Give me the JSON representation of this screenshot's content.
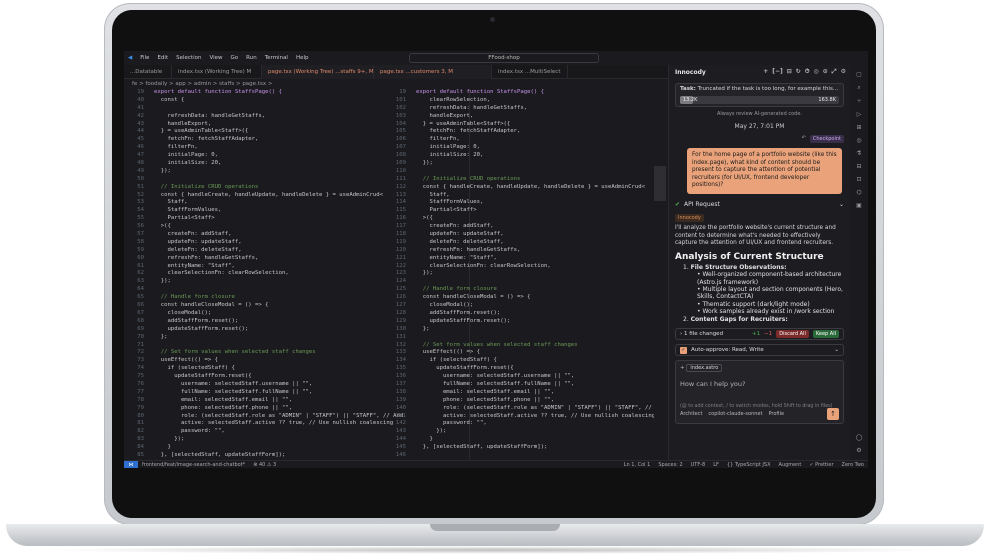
{
  "menu": {
    "logo": "◀",
    "items": [
      "File",
      "Edit",
      "Selection",
      "View",
      "Go",
      "Run",
      "Terminal",
      "Help"
    ]
  },
  "command_center": "FFood-shop",
  "tabs_left": [
    {
      "label": "...Datatable",
      "active": false
    },
    {
      "label": "index.tsx (Working Tree)  M",
      "active": false
    },
    {
      "label": "page.tsx (Working Tree) ...staffs 9+, M",
      "active": true
    }
  ],
  "tabs_right": [
    {
      "label": "page.tsx ...customers  3, M",
      "active": true
    },
    {
      "label": "index.tsx ...MultiSelect",
      "active": false
    }
  ],
  "breadcrumb": "fe > foodaily > app > admin > staffs > page.tsx >",
  "left_code": [
    {
      "n": "19",
      "t": "export default function StaffsPage() {",
      "k": "kw"
    },
    {
      "n": "40",
      "t": "  const {",
      "k": ""
    },
    {
      "n": "41",
      "t": "",
      "k": ""
    },
    {
      "n": "42",
      "t": "    refreshData: handleGetStaffs,",
      "k": ""
    },
    {
      "n": "43",
      "t": "    handleExport,",
      "k": ""
    },
    {
      "n": "44",
      "t": "  } = useAdminTable<Staff>({",
      "k": ""
    },
    {
      "n": "45",
      "t": "    fetchFn: fetchStaffAdapter,",
      "k": ""
    },
    {
      "n": "46",
      "t": "    filterFn,",
      "k": ""
    },
    {
      "n": "47",
      "t": "    initialPage: 0,",
      "k": ""
    },
    {
      "n": "48",
      "t": "    initialSize: 20,",
      "k": ""
    },
    {
      "n": "49",
      "t": "  });",
      "k": ""
    },
    {
      "n": "50",
      "t": "",
      "k": ""
    },
    {
      "n": "51",
      "t": "  // Initialize CRUD operations",
      "k": "cm"
    },
    {
      "n": "52",
      "t": "  const { handleCreate, handleUpdate, handleDelete } = useAdminCrud<",
      "k": ""
    },
    {
      "n": "53",
      "t": "    Staff,",
      "k": ""
    },
    {
      "n": "54",
      "t": "    StaffFormValues,",
      "k": ""
    },
    {
      "n": "55",
      "t": "    Partial<Staff>",
      "k": ""
    },
    {
      "n": "56",
      "t": "  >({",
      "k": ""
    },
    {
      "n": "57",
      "t": "    createFn: addStaff,",
      "k": ""
    },
    {
      "n": "58",
      "t": "    updateFn: updateStaff,",
      "k": ""
    },
    {
      "n": "59",
      "t": "    deleteFn: deleteStaff,",
      "k": ""
    },
    {
      "n": "60",
      "t": "    refreshFn: handleGetStaffs,",
      "k": ""
    },
    {
      "n": "61",
      "t": "    entityName: \"Staff\",",
      "k": ""
    },
    {
      "n": "62",
      "t": "    clearSelectionFn: clearRowSelection,",
      "k": ""
    },
    {
      "n": "63",
      "t": "  });",
      "k": ""
    },
    {
      "n": "64",
      "t": "",
      "k": ""
    },
    {
      "n": "65",
      "t": "  // Handle form closure",
      "k": "cm"
    },
    {
      "n": "66",
      "t": "  const handleCloseModal = () => {",
      "k": ""
    },
    {
      "n": "67",
      "t": "    closeModal();",
      "k": ""
    },
    {
      "n": "68",
      "t": "    addStaffForm.reset();",
      "k": ""
    },
    {
      "n": "69",
      "t": "    updateStaffForm.reset();",
      "k": ""
    },
    {
      "n": "70",
      "t": "  };",
      "k": ""
    },
    {
      "n": "71",
      "t": "",
      "k": ""
    },
    {
      "n": "72",
      "t": "  // Set form values when selected staff changes",
      "k": "cm"
    },
    {
      "n": "73",
      "t": "  useEffect(() => {",
      "k": ""
    },
    {
      "n": "74",
      "t": "    if (selectedStaff) {",
      "k": ""
    },
    {
      "n": "75",
      "t": "      updateStaffForm.reset({",
      "k": ""
    },
    {
      "n": "76",
      "t": "        username: selectedStaff.username || \"\",",
      "k": ""
    },
    {
      "n": "77",
      "t": "        fullName: selectedStaff.fullName || \"\",",
      "k": ""
    },
    {
      "n": "78",
      "t": "        email: selectedStaff.email || \"\",",
      "k": ""
    },
    {
      "n": "79",
      "t": "        phone: selectedStaff.phone || \"\",",
      "k": ""
    },
    {
      "n": "80",
      "t": "        role: (selectedStaff.role as \"ADMIN\" | \"STAFF\") || \"STAFF\", // Add",
      "k": ""
    },
    {
      "n": "81",
      "t": "        active: selectedStaff.active ?? true, // Use nullish coalescing",
      "k": ""
    },
    {
      "n": "82",
      "t": "        password: \"\",",
      "k": ""
    },
    {
      "n": "83",
      "t": "      });",
      "k": ""
    },
    {
      "n": "84",
      "t": "    }",
      "k": ""
    },
    {
      "n": "85",
      "t": "  }, [selectedStaff, updateStaffForm]);",
      "k": ""
    },
    {
      "n": "86",
      "t": "",
      "k": ""
    },
    {
      "n": "87",
      "t": "  // CRUD Operations",
      "k": "cm"
    }
  ],
  "right_code": [
    {
      "n": "19",
      "t": "export default function StaffsPage() {",
      "k": "kw"
    },
    {
      "n": "101",
      "t": "    clearRowSelection,",
      "k": ""
    },
    {
      "n": "102",
      "t": "    refreshData: handleGetStaffs,",
      "k": ""
    },
    {
      "n": "103",
      "t": "    handleExport,",
      "k": ""
    },
    {
      "n": "104",
      "t": "  } = useAdminTable<Staff>({",
      "k": ""
    },
    {
      "n": "105",
      "t": "    fetchFn: fetchStaffAdapter,",
      "k": ""
    },
    {
      "n": "106",
      "t": "    filterFn,",
      "k": ""
    },
    {
      "n": "107",
      "t": "    initialPage: 0,",
      "k": ""
    },
    {
      "n": "108",
      "t": "    initialSize: 20,",
      "k": ""
    },
    {
      "n": "109",
      "t": "  });",
      "k": ""
    },
    {
      "n": "110",
      "t": "",
      "k": ""
    },
    {
      "n": "111",
      "t": "  // Initialize CRUD operations",
      "k": "cm"
    },
    {
      "n": "112",
      "t": "  const { handleCreate, handleUpdate, handleDelete } = useAdminCrud<",
      "k": ""
    },
    {
      "n": "113",
      "t": "    Staff,",
      "k": ""
    },
    {
      "n": "114",
      "t": "    StaffFormValues,",
      "k": ""
    },
    {
      "n": "115",
      "t": "    Partial<Staff>",
      "k": ""
    },
    {
      "n": "116",
      "t": "  >({",
      "k": ""
    },
    {
      "n": "117",
      "t": "    createFn: addStaff,",
      "k": ""
    },
    {
      "n": "118",
      "t": "    updateFn: updateStaff,",
      "k": ""
    },
    {
      "n": "119",
      "t": "    deleteFn: deleteStaff,",
      "k": ""
    },
    {
      "n": "120",
      "t": "    refreshFn: handleGetStaffs,",
      "k": ""
    },
    {
      "n": "121",
      "t": "    entityName: \"Staff\",",
      "k": ""
    },
    {
      "n": "122",
      "t": "    clearSelectionFn: clearRowSelection,",
      "k": ""
    },
    {
      "n": "123",
      "t": "  });",
      "k": ""
    },
    {
      "n": "124",
      "t": "",
      "k": ""
    },
    {
      "n": "125",
      "t": "  // Handle form closure",
      "k": "cm"
    },
    {
      "n": "126",
      "t": "  const handleCloseModal = () => {",
      "k": ""
    },
    {
      "n": "127",
      "t": "    closeModal();",
      "k": ""
    },
    {
      "n": "128",
      "t": "    addStaffForm.reset();",
      "k": ""
    },
    {
      "n": "129",
      "t": "    updateStaffForm.reset();",
      "k": ""
    },
    {
      "n": "130",
      "t": "  };",
      "k": ""
    },
    {
      "n": "131",
      "t": "",
      "k": ""
    },
    {
      "n": "132",
      "t": "  // Set form values when selected staff changes",
      "k": "cm"
    },
    {
      "n": "133",
      "t": "  useEffect(() => {",
      "k": ""
    },
    {
      "n": "134",
      "t": "    if (selectedStaff) {",
      "k": ""
    },
    {
      "n": "135",
      "t": "      updateStaffForm.reset({",
      "k": ""
    },
    {
      "n": "136",
      "t": "        username: selectedStaff.username || \"\",",
      "k": ""
    },
    {
      "n": "137",
      "t": "        fullName: selectedStaff.fullName || \"\",",
      "k": ""
    },
    {
      "n": "138",
      "t": "        email: selectedStaff.email || \"\",",
      "k": ""
    },
    {
      "n": "139",
      "t": "        phone: selectedStaff.phone || \"\",",
      "k": ""
    },
    {
      "n": "140",
      "t": "        role: (selectedStaff.role as \"ADMIN\" | \"STAFF\") || \"STAFF\", // Add",
      "k": ""
    },
    {
      "n": "141",
      "t": "        active: selectedStaff.active ?? true, // Use nullish coalescing",
      "k": ""
    },
    {
      "n": "142",
      "t": "        password: \"\",",
      "k": ""
    },
    {
      "n": "143",
      "t": "      });",
      "k": ""
    },
    {
      "n": "144",
      "t": "    }",
      "k": ""
    },
    {
      "n": "145",
      "t": "  }, [selectedStaff, updateStaffForm]);",
      "k": ""
    },
    {
      "n": "146",
      "t": "",
      "k": ""
    },
    {
      "n": "147",
      "t": "  // CRUD Operations",
      "k": "cm"
    }
  ],
  "status": {
    "branch": "frontend/feat/image-search-and-chatbot*",
    "problems": "⊗ 40 ⚠ 3",
    "position": "Ln 1, Col 1",
    "spaces": "Spaces: 2",
    "encoding": "UTF-8",
    "eol": "LF",
    "language": "{} TypeScript JSX",
    "augment": "Augment",
    "prettier": "✓ Prettier",
    "theme": "Zero Two"
  },
  "chat": {
    "title": "Innocody",
    "header_icons": [
      "+",
      "[−]",
      "⊟",
      "↻",
      "⏱",
      "◎",
      "⊙",
      "⤢",
      "⚙"
    ],
    "task_label": "Task:",
    "task_text": "Truncated if the task is too long, for example this...",
    "progress_fraction": 0.08,
    "progress_left": "13.2K",
    "progress_right": "163.8K",
    "review_note": "Always review AI-generated code.",
    "date": "May 27, 7:01 PM",
    "checkpoint_label": "Checkpoint",
    "user_message": "For the home page of a portfolio website (like this index.page), what kind of content should be present to capture the attention of potential recruiters (for UI/UX, frontend developer positions)?",
    "api_request": "API Request",
    "agent_badge": "Innocody",
    "response_intro": "I'll analyze the portfolio website's current structure and content to determine what's needed to effectively capture the attention of UI/UX and frontend recruiters.",
    "heading": "Analysis of Current Structure",
    "sections": [
      {
        "num": "1.",
        "title": "File Structure Observations:",
        "bullets": [
          "Well-organized component-based architecture (Astro.js framework)",
          "Multiple layout and section components (Hero, Skills, ContactCTA)",
          "Thematic support (dark/light mode)",
          "Work samples already exist in /work section"
        ]
      },
      {
        "num": "2.",
        "title": "Content Gaps for Recruiters:",
        "bullets": []
      }
    ],
    "files_changed": "1 file changed",
    "added": "+1",
    "removed": "−1",
    "discard_all": "Discard All",
    "keep_all": "Keep All",
    "auto_approve": "Auto-approve: Read, Write",
    "context_file": "index.astro",
    "input_placeholder": "How can I help you?",
    "input_hint": "(@ to add context, / to switch modes, hold Shift to drag in files)",
    "mode": "Architect",
    "model": "copilot-claude-sonnet",
    "profile": "Profile"
  },
  "colors": {
    "accent": "#e9a27a",
    "background": "#1b1b1f",
    "status_blue": "#2f6fd1"
  }
}
